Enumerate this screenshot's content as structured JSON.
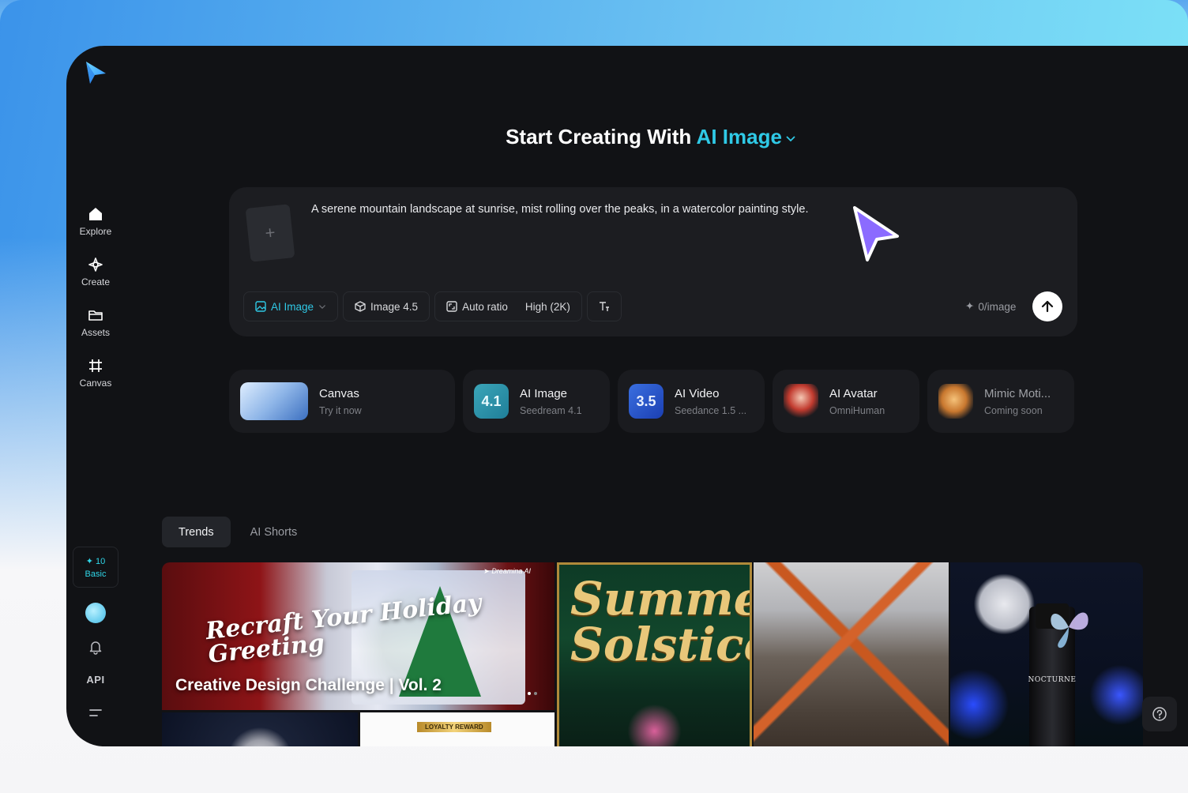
{
  "colors": {
    "accent": "#2fc9e6",
    "window_bg": "#111215",
    "card_bg": "#1c1d21",
    "cursor": "#8b6bff"
  },
  "sidebar": {
    "items": [
      {
        "label": "Explore",
        "icon": "home-icon"
      },
      {
        "label": "Create",
        "icon": "sparkle-icon"
      },
      {
        "label": "Assets",
        "icon": "folder-icon"
      },
      {
        "label": "Canvas",
        "icon": "frame-icon"
      }
    ],
    "credits": {
      "count": "10",
      "tier": "Basic"
    },
    "api_label": "API"
  },
  "headline": {
    "prefix": "Start Creating With",
    "accent": "AI Image"
  },
  "prompt": {
    "text": "A serene mountain landscape at sunrise, mist rolling over the peaks, in a watercolor painting style.",
    "upload_glyph": "+",
    "toolbar": {
      "mode": "AI Image",
      "model": "Image 4.5",
      "ratio": "Auto ratio",
      "quality": "High (2K)"
    },
    "cost": "0/image"
  },
  "features": [
    {
      "title": "Canvas",
      "subtitle": "Try it now"
    },
    {
      "title": "AI Image",
      "subtitle": "Seedream 4.1",
      "badge": "4.1"
    },
    {
      "title": "AI Video",
      "subtitle": "Seedance 1.5 ...",
      "badge": "3.5"
    },
    {
      "title": "AI Avatar",
      "subtitle": "OmniHuman"
    },
    {
      "title": "Mimic Moti...",
      "subtitle": "Coming soon"
    }
  ],
  "tabs": [
    {
      "label": "Trends"
    },
    {
      "label": "AI Shorts"
    }
  ],
  "gallery": {
    "banner": {
      "art_title": "Recraft Your Holiday Greeting",
      "caption": "Creative Design Challenge | Vol. 2",
      "brand": "Dreamina AI"
    },
    "loyalty_badge": "LOYALTY REWARD",
    "summer_title": "Summer Solstice",
    "nocturne_label": "NOCTURNE"
  }
}
